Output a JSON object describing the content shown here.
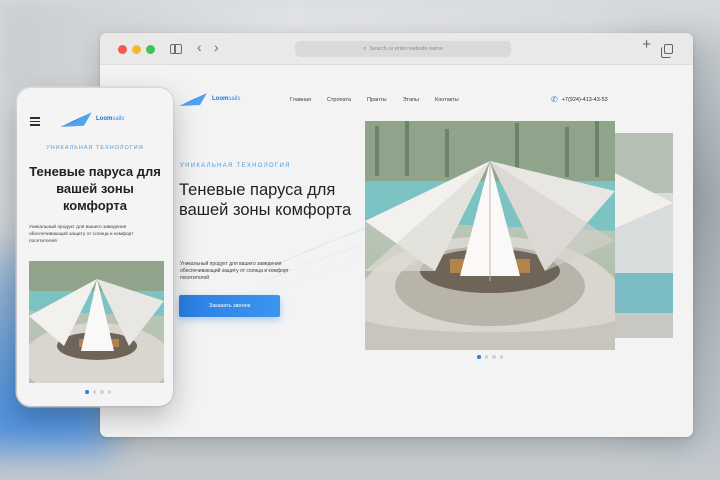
{
  "browser": {
    "url_placeholder": "Search or enter website name",
    "icons": [
      "sidebar-icon",
      "back-icon",
      "forward-icon",
      "search-icon",
      "new-tab-icon",
      "tabs-icon"
    ]
  },
  "site": {
    "logo_bold": "Loom",
    "logo_light": "sails",
    "nav": [
      "Главная",
      "Стропата",
      "Пранты",
      "Этапы",
      "Контакты"
    ],
    "phone": "+7(924)-413-43-53",
    "eyebrow": "Уникальная технология",
    "title": "Теневые паруса для вашей зоны комфорта",
    "description": "Уникальный продукт для вашего заведения обеспечивающий защиту от солнца и комфорт посетителей",
    "cta": "Заказать звонок",
    "slides_total": 4,
    "slide_active": 1
  },
  "mobile": {
    "logo_bold": "Loom",
    "logo_light": "sails",
    "eyebrow": "Уникальная технология",
    "title": "Теневые паруса для вашей зоны комфорта",
    "description": "Уникальный продукт для вашего заведения обеспечивающий защиту от солнца и комфорт посетителей",
    "slides_total": 4,
    "slide_active": 1
  },
  "colors": {
    "accent": "#2f7fe0",
    "eyebrow": "#4d9bd8",
    "traffic_red": "#f05a52",
    "traffic_yellow": "#f5b731",
    "traffic_green": "#3ec35a"
  }
}
